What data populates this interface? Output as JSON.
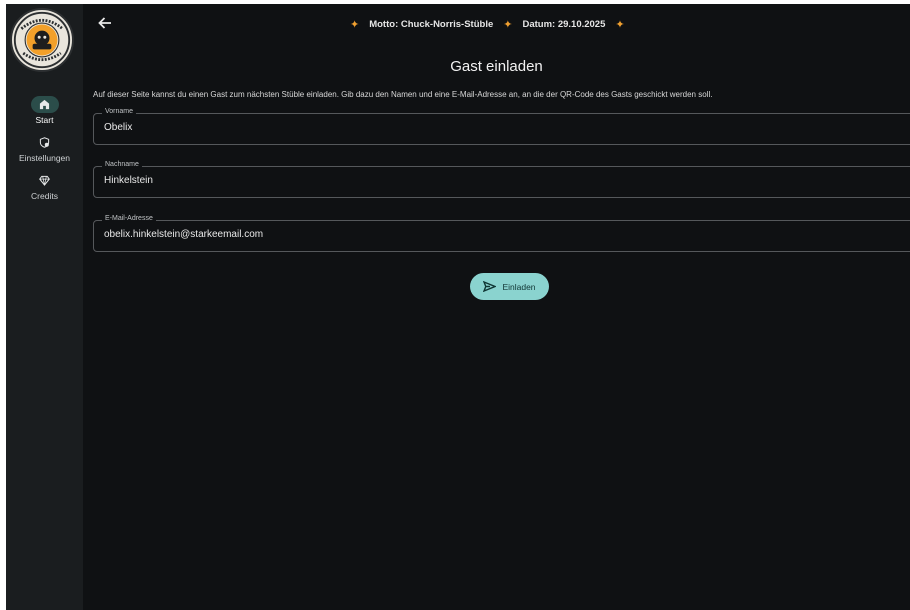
{
  "header": {
    "motto": "Motto: Chuck-Norris-Stüble",
    "date": "Datum: 29.10.2025"
  },
  "logo": {
    "text_top": "WOHNHEIME HFS &",
    "text_right": "SÜHRE",
    "text_bottom": "STÜBLE"
  },
  "nav": {
    "items": [
      {
        "label": "Start",
        "icon": "home-icon",
        "active": true
      },
      {
        "label": "Einstellungen",
        "icon": "shield-icon",
        "active": false
      },
      {
        "label": "Credits",
        "icon": "diamond-icon",
        "active": false
      }
    ]
  },
  "page": {
    "title": "Gast einladen",
    "description": "Auf dieser Seite kannst du einen Gast zum nächsten Stüble einladen. Gib dazu den Namen und eine E-Mail-Adresse an, an die der QR-Code des Gasts geschickt werden soll."
  },
  "form": {
    "firstname": {
      "label": "Vorname",
      "value": "Obelix"
    },
    "lastname": {
      "label": "Nachname",
      "value": "Hinkelstein"
    },
    "email": {
      "label": "E-Mail-Adresse",
      "value": "obelix.hinkelstein@starkeemail.com"
    },
    "submit_label": "Einladen"
  },
  "colors": {
    "accent": "#8ad3cf",
    "star": "#f0a030",
    "background": "#0f1113",
    "sidebar": "#1a1d1f"
  }
}
